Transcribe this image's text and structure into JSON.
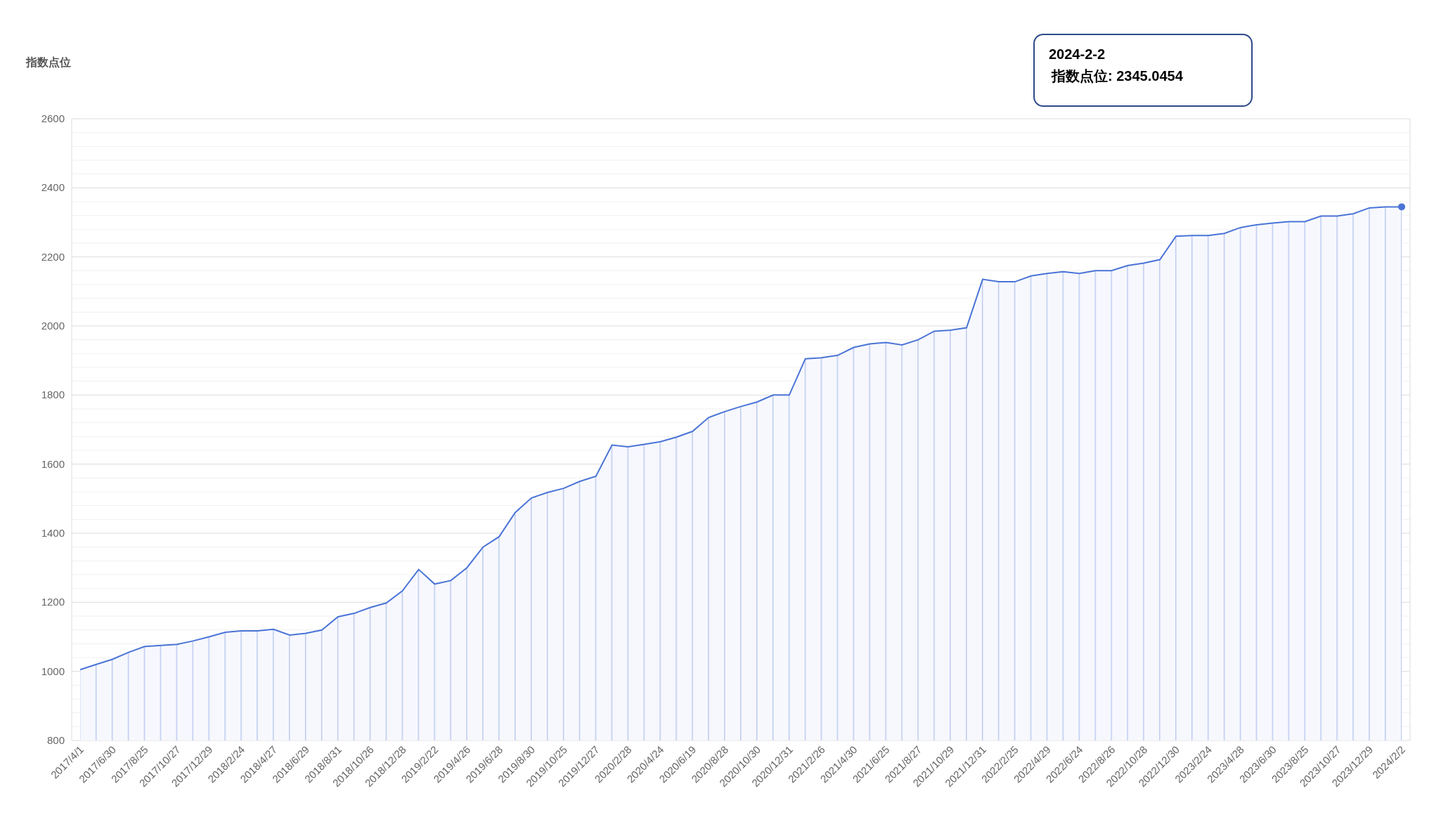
{
  "tooltip": {
    "date": "2024-2-2",
    "text": "指数点位: 2345.0454"
  },
  "chart_data": {
    "type": "area",
    "ylabel": "指数点位",
    "ylim": [
      800,
      2600
    ],
    "yticks": [
      800,
      1000,
      1200,
      1400,
      1600,
      1800,
      2000,
      2200,
      2400,
      2600
    ],
    "grid": true,
    "categories": [
      "2017/4/1",
      null,
      "2017/6/30",
      null,
      "2017/8/25",
      null,
      "2017/10/27",
      null,
      "2017/12/29",
      null,
      "2018/2/24",
      null,
      "2018/4/27",
      null,
      "2018/6/29",
      null,
      "2018/8/31",
      null,
      "2018/10/26",
      null,
      "2018/12/28",
      null,
      "2019/2/22",
      null,
      "2019/4/26",
      null,
      "2019/6/28",
      null,
      "2019/8/30",
      null,
      "2019/10/25",
      null,
      "2019/12/27",
      null,
      "2020/2/28",
      null,
      "2020/4/24",
      null,
      "2020/6/19",
      null,
      "2020/8/28",
      null,
      "2020/10/30",
      null,
      "2020/12/31",
      null,
      "2021/2/26",
      null,
      "2021/4/30",
      null,
      "2021/6/25",
      null,
      "2021/8/27",
      null,
      "2021/10/29",
      null,
      "2021/12/31",
      null,
      "2022/2/25",
      null,
      "2022/4/29",
      null,
      "2022/6/24",
      null,
      "2022/8/26",
      null,
      "2022/10/28",
      null,
      "2022/12/30",
      null,
      "2023/2/24",
      null,
      "2023/4/28",
      null,
      "2023/6/30",
      null,
      "2023/8/25",
      null,
      "2023/10/27",
      null,
      "2023/12/29",
      null,
      "2024/2/2"
    ],
    "series": [
      {
        "color": "#4a74d6",
        "values": [
          1005,
          1020,
          1035,
          1055,
          1072,
          1075,
          1078,
          1088,
          1100,
          1113,
          1117,
          1117,
          1122,
          1105,
          1110,
          1120,
          1158,
          1168,
          1185,
          1198,
          1233,
          1295,
          1253,
          1263,
          1300,
          1360,
          1390,
          1460,
          1502,
          1518,
          1530,
          1550,
          1565,
          1655,
          1650,
          1657,
          1665,
          1678,
          1695,
          1735,
          1752,
          1767,
          1780,
          1800,
          1800,
          1905,
          1908,
          1915,
          1938,
          1948,
          1952,
          1945,
          1960,
          1985,
          1988,
          1995,
          2135,
          2128,
          2128,
          2145,
          2152,
          2157,
          2152,
          2160,
          2160,
          2175,
          2182,
          2192,
          2260,
          2262,
          2262,
          2268,
          2285,
          2293,
          2298,
          2302,
          2302,
          2318,
          2318,
          2325,
          2342,
          2345,
          2345
        ]
      }
    ]
  }
}
